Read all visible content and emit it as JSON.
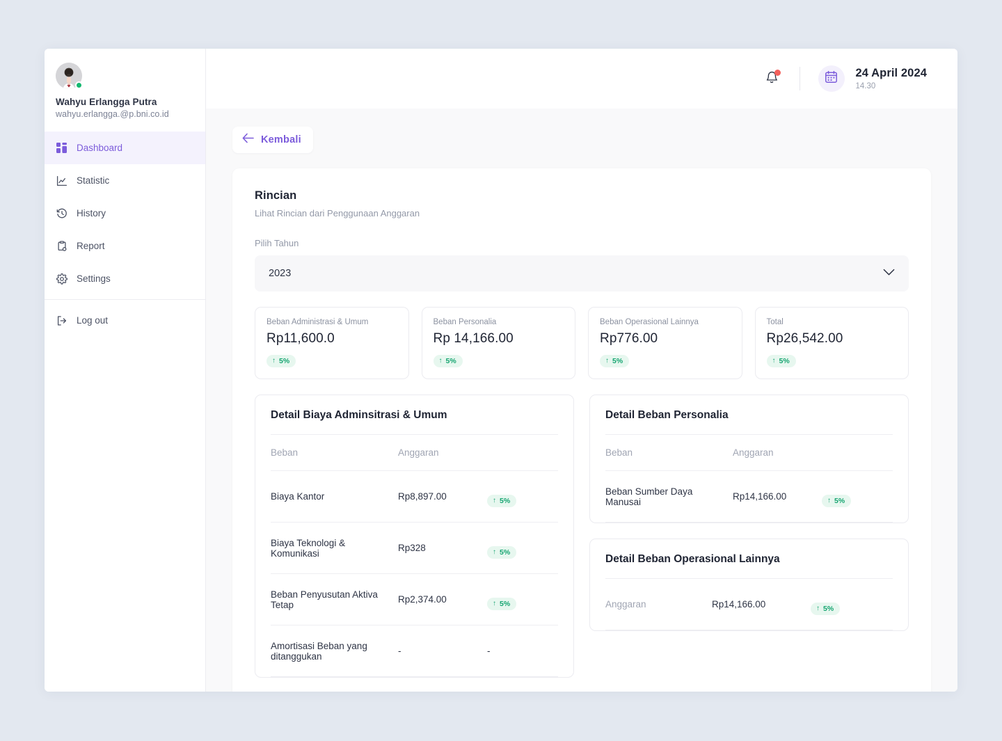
{
  "colors": {
    "page_bg": "#e3e8f0",
    "accent_purple": "#7c5cdb",
    "badge_green_text": "#16a571",
    "badge_green_bg": "#e7f7ef",
    "status_online": "#14b870",
    "notification_dot": "#f3605c"
  },
  "sidebar": {
    "profile": {
      "name": "Wahyu Erlangga Putra",
      "email": "wahyu.erlangga.@p.bni.co.id",
      "avatar_icon": "user-avatar",
      "status_icon": "online-status-dot"
    },
    "items": [
      {
        "label": "Dashboard",
        "icon": "dashboard-icon",
        "active": true
      },
      {
        "label": "Statistic",
        "icon": "chart-icon",
        "active": false
      },
      {
        "label": "History",
        "icon": "clock-history-icon",
        "active": false
      },
      {
        "label": "Report",
        "icon": "clipboard-icon",
        "active": false
      },
      {
        "label": "Settings",
        "icon": "gear-icon",
        "active": false
      }
    ],
    "logout": {
      "label": "Log out",
      "icon": "logout-icon"
    }
  },
  "topbar": {
    "bell_icon": "notification-bell-icon",
    "calendar_icon": "calendar-icon",
    "date": "24 April 2024",
    "time": "14.30"
  },
  "back_button": {
    "label": "Kembali",
    "icon": "arrow-left-icon"
  },
  "page": {
    "title": "Rincian",
    "subtitle": "Lihat Rincian dari Penggunaan Anggaran",
    "year_field_label": "Pilih Tahun",
    "year_selected": "2023",
    "year_chevron_icon": "chevron-down-icon"
  },
  "stats": [
    {
      "label": "Beban Administrasi & Umum",
      "value": "Rp11,600.0",
      "delta": "5%",
      "delta_dir": "up"
    },
    {
      "label": "Beban Personalia",
      "value": "Rp 14,166.00",
      "delta": "5%",
      "delta_dir": "up"
    },
    {
      "label": "Beban Operasional Lainnya",
      "value": "Rp776.00",
      "delta": "5%",
      "delta_dir": "up"
    },
    {
      "label": "Total",
      "value": "Rp26,542.00",
      "delta": "5%",
      "delta_dir": "up"
    }
  ],
  "detail_admin": {
    "title": "Detail Biaya Adminsitrasi & Umum",
    "columns": {
      "beban": "Beban",
      "anggaran": "Anggaran"
    },
    "rows": [
      {
        "beban": "Biaya Kantor",
        "anggaran": "Rp8,897.00",
        "delta": "5%"
      },
      {
        "beban": "Biaya Teknologi & Komunikasi",
        "anggaran": "Rp328",
        "delta": "5%"
      },
      {
        "beban": "Beban Penyusutan Aktiva Tetap",
        "anggaran": "Rp2,374.00",
        "delta": "5%"
      },
      {
        "beban": "Amortisasi Beban yang ditanggukan",
        "anggaran": "-",
        "delta": "-"
      }
    ]
  },
  "detail_personalia": {
    "title": "Detail Beban Personalia",
    "columns": {
      "beban": "Beban",
      "anggaran": "Anggaran"
    },
    "rows": [
      {
        "beban": "Beban Sumber Daya Manusai",
        "anggaran": "Rp14,166.00",
        "delta": "5%"
      }
    ]
  },
  "detail_operasional": {
    "title": "Detail Beban Operasional Lainnya",
    "rows": [
      {
        "beban": "Anggaran",
        "anggaran": "Rp14,166.00",
        "delta": "5%"
      }
    ]
  }
}
